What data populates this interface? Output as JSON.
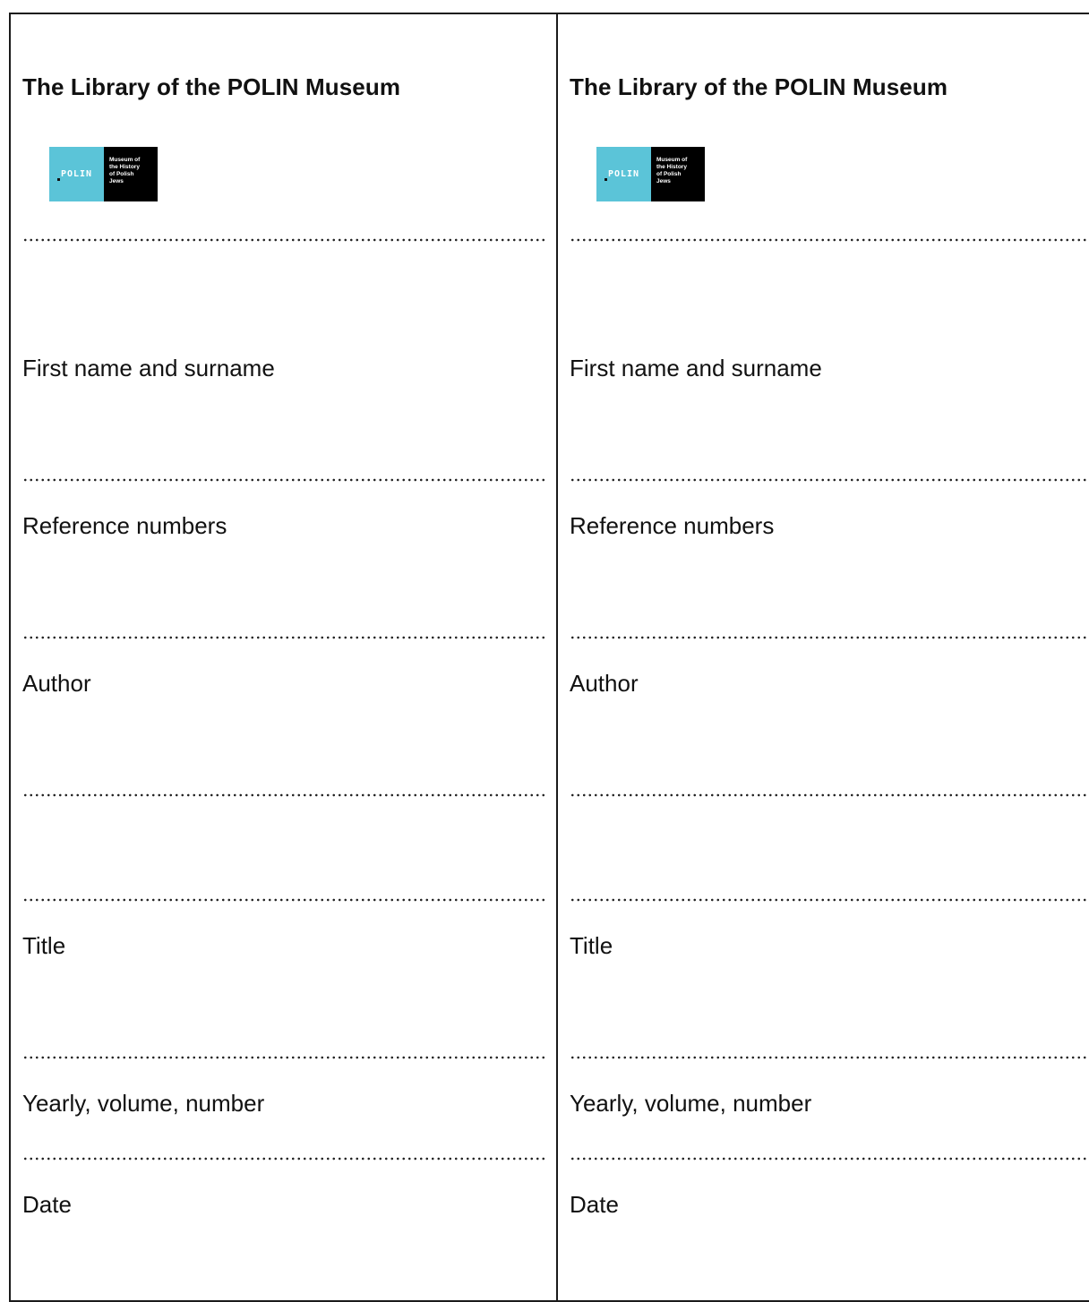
{
  "slips": [
    {
      "title": "The Library of the POLIN Museum",
      "logo": {
        "wordmark": "POLIN",
        "tagline": "Museum of\nthe History\nof Polish\nJews",
        "accent_color": "#5bc4d8"
      },
      "fields": [
        {
          "label": "First name and surname"
        },
        {
          "label": "Reference numbers"
        },
        {
          "label": "Author"
        },
        {
          "label": ""
        },
        {
          "label": "Title"
        },
        {
          "label": "Yearly, volume, number"
        },
        {
          "label": "Date"
        }
      ]
    },
    {
      "title": "The Library of the POLIN Museum",
      "logo": {
        "wordmark": "POLIN",
        "tagline": "Museum of\nthe History\nof Polish\nJews",
        "accent_color": "#5bc4d8"
      },
      "fields": [
        {
          "label": "First name and surname"
        },
        {
          "label": "Reference numbers"
        },
        {
          "label": "Author"
        },
        {
          "label": ""
        },
        {
          "label": "Title"
        },
        {
          "label": "Yearly, volume, number"
        },
        {
          "label": "Date"
        }
      ]
    }
  ]
}
